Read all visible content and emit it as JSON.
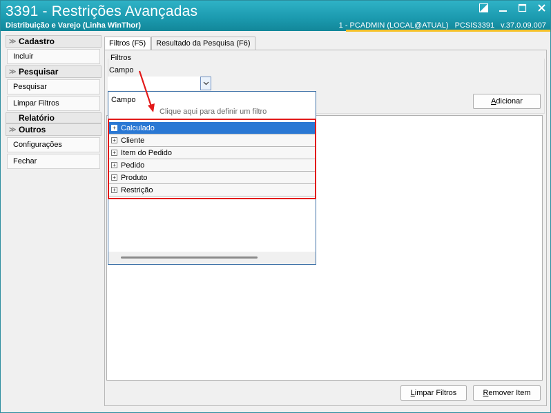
{
  "window": {
    "title": "3391 - Restrições Avançadas",
    "subtitle": "Distribuição e Varejo (Linha WinThor)",
    "user_info": "1 - PCADMIN (LOCAL@ATUAL)",
    "routine": "PCSIS3391",
    "version": "v.37.0.09.007",
    "accent_color": "#1c9bb0",
    "highlight_color": "#f5c22a"
  },
  "sidebar": {
    "cadastro": {
      "header": "Cadastro",
      "items": [
        "Incluir"
      ]
    },
    "pesquisar": {
      "header": "Pesquisar",
      "items": [
        "Pesquisar",
        "Limpar Filtros"
      ]
    },
    "relatorio": {
      "header": "Relatório"
    },
    "outros": {
      "header": "Outros",
      "items": [
        "Configurações",
        "Fechar"
      ]
    }
  },
  "tabs": [
    {
      "label": "Filtros (F5)",
      "active": true
    },
    {
      "label": "Resultado da Pesquisa (F6)",
      "active": false
    }
  ],
  "filtros": {
    "group_label": "Filtros",
    "campo_label": "Campo",
    "campo_value": "",
    "adicionar_prefix": "A",
    "adicionar_rest": "dicionar"
  },
  "dropdown": {
    "header_label": "Campo",
    "hint": "Clique aqui para definir um filtro",
    "items": [
      "Calculado",
      "Cliente",
      "Item do Pedido",
      "Pedido",
      "Produto",
      "Restrição"
    ],
    "selected_index": 0
  },
  "buttons": {
    "limpar_prefix": "L",
    "limpar_rest": "impar Filtros",
    "remover_prefix": "R",
    "remover_rest": "emover Item"
  },
  "annotation": {
    "color": "#e21a1a"
  }
}
